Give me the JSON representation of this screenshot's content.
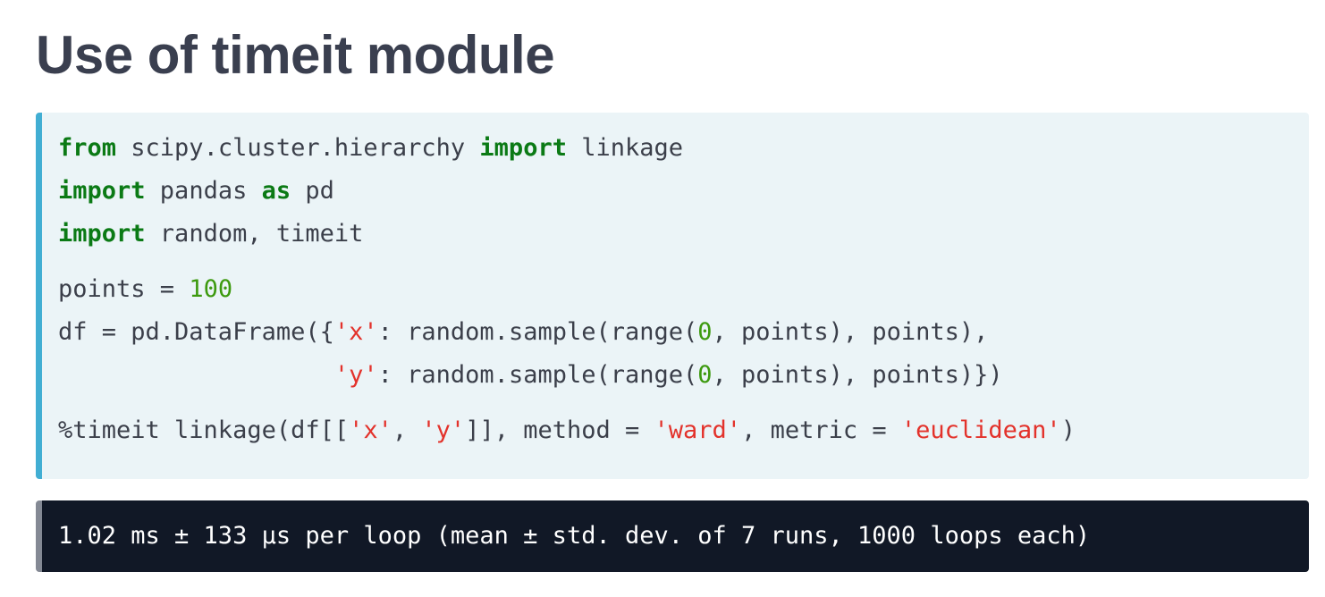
{
  "page": {
    "title": "Use of timeit module"
  },
  "code": {
    "lines": [
      [
        {
          "text": "from",
          "kind": "keyword"
        },
        {
          "text": " scipy.cluster.hierarchy ",
          "kind": "plain"
        },
        {
          "text": "import",
          "kind": "keyword"
        },
        {
          "text": " linkage",
          "kind": "plain"
        }
      ],
      [
        {
          "text": "import",
          "kind": "keyword"
        },
        {
          "text": " pandas ",
          "kind": "plain"
        },
        {
          "text": "as",
          "kind": "keyword"
        },
        {
          "text": " pd",
          "kind": "plain"
        }
      ],
      [
        {
          "text": "import",
          "kind": "keyword"
        },
        {
          "text": " random, timeit",
          "kind": "plain"
        }
      ],
      [
        {
          "text": "points = ",
          "kind": "plain"
        },
        {
          "text": "100",
          "kind": "number"
        }
      ],
      [
        {
          "text": "df = pd.DataFrame({",
          "kind": "plain"
        },
        {
          "text": "'x'",
          "kind": "string"
        },
        {
          "text": ": random.sample(range(",
          "kind": "plain"
        },
        {
          "text": "0",
          "kind": "number"
        },
        {
          "text": ", points), points),",
          "kind": "plain"
        }
      ],
      [
        {
          "text": "                   ",
          "kind": "plain"
        },
        {
          "text": "'y'",
          "kind": "string"
        },
        {
          "text": ": random.sample(range(",
          "kind": "plain"
        },
        {
          "text": "0",
          "kind": "number"
        },
        {
          "text": ", points), points)})",
          "kind": "plain"
        }
      ],
      [
        {
          "text": "%timeit linkage(df[[",
          "kind": "plain"
        },
        {
          "text": "'x'",
          "kind": "string"
        },
        {
          "text": ", ",
          "kind": "plain"
        },
        {
          "text": "'y'",
          "kind": "string"
        },
        {
          "text": "]], method = ",
          "kind": "plain"
        },
        {
          "text": "'ward'",
          "kind": "string"
        },
        {
          "text": ", metric = ",
          "kind": "plain"
        },
        {
          "text": "'euclidean'",
          "kind": "string"
        },
        {
          "text": ")",
          "kind": "plain"
        }
      ]
    ]
  },
  "output": {
    "text": "1.02 ms ± 133 µs per loop (mean ± std. dev. of 7 runs, 1000 loops each)"
  },
  "colors": {
    "keyword": "#0b7a15",
    "number": "#3d9a0f",
    "string": "#e3322b",
    "code_background": "#ebf4f7",
    "code_accent": "#41aed3",
    "output_background": "#111826"
  }
}
